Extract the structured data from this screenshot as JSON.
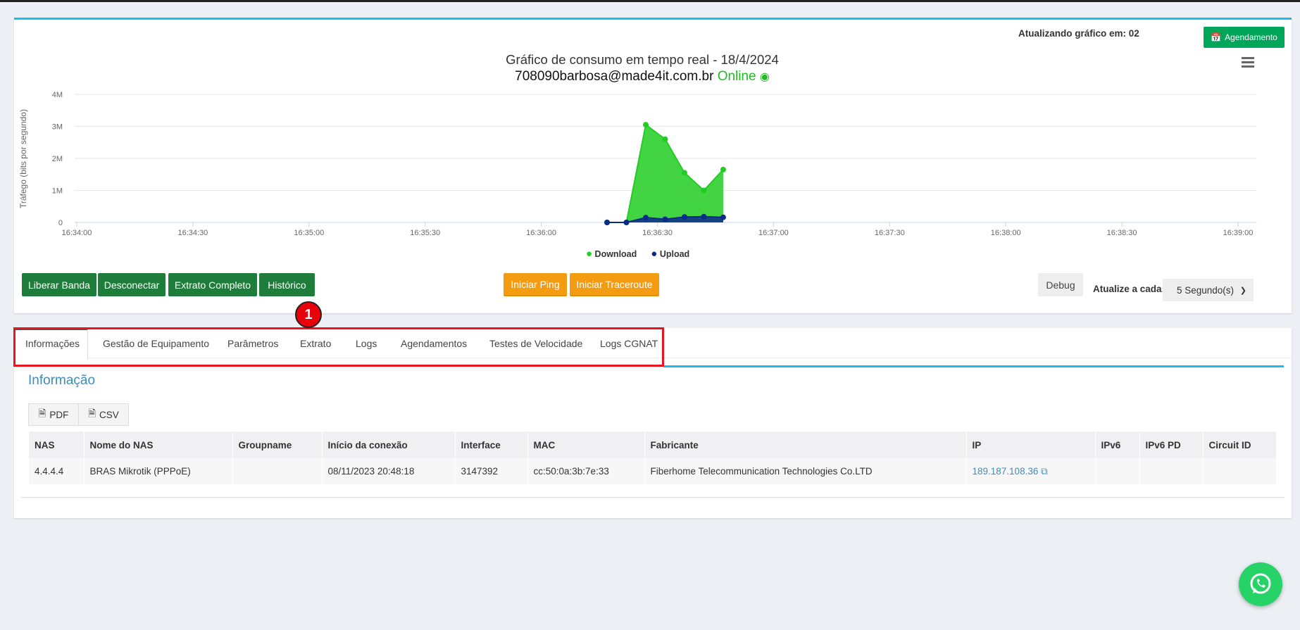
{
  "header": {
    "refresh_text": "Atualizando gráfico em: 02",
    "schedule_button": "Agendamento"
  },
  "chart_data": {
    "type": "area",
    "title": "Gráfico de consumo em tempo real - 18/4/2024",
    "subtitle_user": "708090barbosa@made4it.com.br",
    "subtitle_status": "Online",
    "ylabel": "Tráfego (bits por segundo)",
    "ytick_labels": [
      "0",
      "1M",
      "2M",
      "3M",
      "4M"
    ],
    "ylim": [
      0,
      4000000
    ],
    "xtick_labels": [
      "16:34:00",
      "16:34:30",
      "16:35:00",
      "16:35:30",
      "16:36:00",
      "16:36:30",
      "16:37:00",
      "16:37:30",
      "16:38:00",
      "16:38:30",
      "16:39:00"
    ],
    "xlim_seconds": [
      0,
      300
    ],
    "x_seconds": [
      137,
      142,
      147,
      152,
      157,
      162,
      167
    ],
    "series": [
      {
        "name": "Download",
        "color": "#22cc22",
        "values": [
          0,
          0,
          3050000,
          2600000,
          1550000,
          1000000,
          1650000
        ]
      },
      {
        "name": "Upload",
        "color": "#0b2a8a",
        "values": [
          0,
          0,
          150000,
          100000,
          170000,
          180000,
          160000
        ]
      }
    ],
    "legend": "bottom",
    "grid": true
  },
  "actions": {
    "liberar": "Liberar Banda",
    "desconectar": "Desconectar",
    "extrato": "Extrato Completo",
    "historico": "Histórico",
    "ping": "Iniciar Ping",
    "traceroute": "Iniciar Traceroute",
    "debug": "Debug",
    "interval_label": "Atualize a cada:",
    "interval_value": "5 Segundo(s)"
  },
  "badge": "1",
  "tabs": [
    "Informações",
    "Gestão de Equipamento",
    "Parâmetros",
    "Extrato",
    "Logs",
    "Agendamentos",
    "Testes de Velocidade",
    "Logs CGNAT"
  ],
  "section_title": "Informação",
  "export": {
    "pdf": "PDF",
    "csv": "CSV"
  },
  "table": {
    "headers": [
      "NAS",
      "Nome do NAS",
      "Groupname",
      "Início da conexão",
      "Interface",
      "MAC",
      "Fabricante",
      "IP",
      "IPv6",
      "IPv6 PD",
      "Circuit ID"
    ],
    "rows": [
      [
        "4.4.4.4",
        "BRAS Mikrotik (PPPoE)",
        "",
        "08/11/2023 20:48:18",
        "3147392",
        "cc:50:0a:3b:7e:33",
        "Fiberhome Telecommunication Technologies Co.LTD",
        "189.187.108.36",
        "",
        "",
        ""
      ]
    ]
  }
}
